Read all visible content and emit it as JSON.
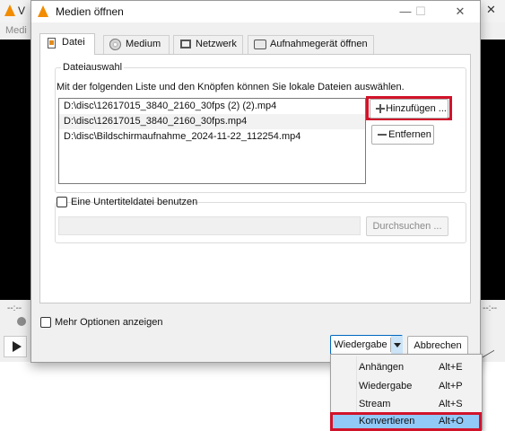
{
  "app": {
    "title_fragment": "V",
    "menu_fragment": "Medi",
    "time_left": "--:--",
    "time_right": "--:--"
  },
  "dialog": {
    "title": "Medien öffnen",
    "controls": {
      "minimize": "—",
      "maximize": "☐",
      "close": "✕"
    },
    "tabs": [
      {
        "label": "Datei",
        "icon": "file-icon",
        "active": true
      },
      {
        "label": "Medium",
        "icon": "disc-icon",
        "active": false
      },
      {
        "label": "Netzwerk",
        "icon": "network-icon",
        "active": false
      },
      {
        "label": "Aufnahmegerät öffnen",
        "icon": "capture-device-icon",
        "active": false
      }
    ],
    "file_selection": {
      "legend": "Dateiauswahl",
      "description": "Mit der folgenden Liste und den Knöpfen können Sie lokale Dateien auswählen.",
      "files": [
        "D:\\disc\\12617015_3840_2160_30fps (2) (2).mp4",
        "D:\\disc\\12617015_3840_2160_30fps.mp4",
        "D:\\disc\\Bildschirmaufnahme_2024-11-22_112254.mp4"
      ],
      "add_button": "Hinzufügen ...",
      "remove_button": "Entfernen"
    },
    "subtitle": {
      "checkbox_label": "Eine Untertiteldatei benutzen",
      "checked": false,
      "browse_button": "Durchsuchen ..."
    },
    "more_options_label": "Mehr Optionen anzeigen",
    "play_dropdown": "Wiedergabe",
    "cancel_button": "Abbrechen"
  },
  "play_menu": {
    "items": [
      {
        "label": "Anhängen",
        "shortcut": "Alt+E"
      },
      {
        "label": "Wiedergabe",
        "shortcut": "Alt+P"
      },
      {
        "label": "Stream",
        "shortcut": "Alt+S"
      },
      {
        "label": "Konvertieren",
        "shortcut": "Alt+O",
        "selected": true
      }
    ]
  },
  "colors": {
    "highlight": "#d1132a",
    "selected_menu": "#91c9f7",
    "vlc_orange": "#f28c00"
  }
}
